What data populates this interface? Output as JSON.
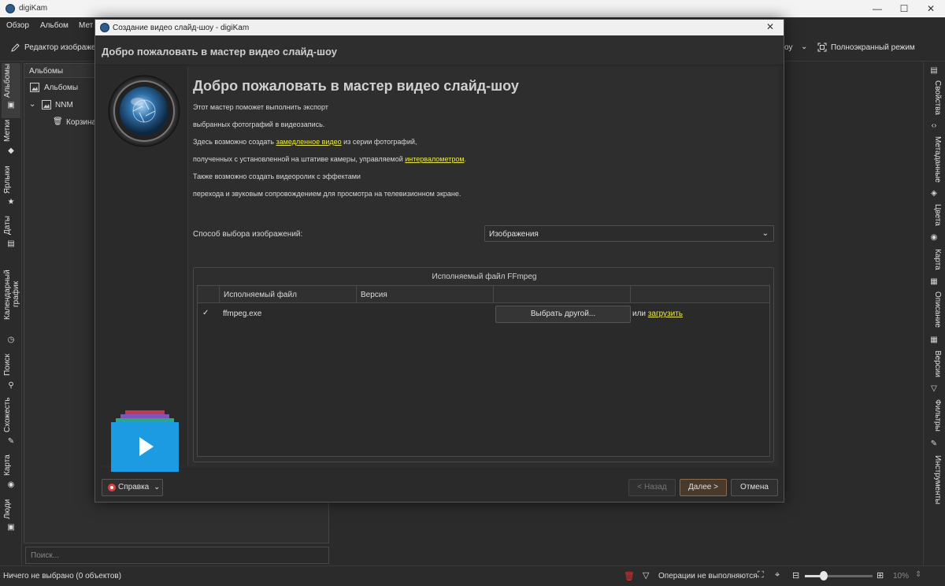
{
  "app": {
    "title": "digiKam",
    "menu": [
      "Обзор",
      "Альбом",
      "Мет"
    ],
    "toolbar": {
      "editor_label": "Редактор изображени",
      "slideshow_fragment": "оу",
      "fullscreen_label": "Полноэкранный режим"
    }
  },
  "left_tabs": [
    "Альбомы",
    "Метки",
    "Ярлыки",
    "Даты",
    "Календарный график",
    "Поиск",
    "Схожесть",
    "Карта",
    "Люди"
  ],
  "right_tabs": [
    "Свойства",
    "Метаданные",
    "Цвета",
    "Карта",
    "Описание",
    "Версии",
    "Фильтры",
    "Инструменты"
  ],
  "albums_panel": {
    "header": "Альбомы",
    "items": [
      "Альбомы",
      "NNM",
      "Корзина"
    ],
    "search_placeholder": "Поиск..."
  },
  "status": {
    "selection": "Ничего не выбрано (0 объектов)",
    "operations": "Операции не выполняются",
    "zoom": "10%"
  },
  "dialog": {
    "title": "Создание видео слайд-шоу - digiKam",
    "header": "Добро пожаловать в мастер видео слайд-шоу",
    "heading": "Добро пожаловать в мастер видео слайд-шоу",
    "paragraphs": {
      "p1": "Этот мастер поможет выполнить экспорт",
      "p2": "выбранных фотографий в видеозапись.",
      "p3_before": "Здесь возможно создать ",
      "p3_link": "замедленное видео",
      "p3_after": " из серии фотографий,",
      "p4_before": "полученных с установленной на штативе камеры, управляемой ",
      "p4_link": "интервалометром",
      "p4_after": ".",
      "p5": "Также возможно создать видеоролик с эффектами",
      "p6": "перехода и звуковым сопровождением для просмотра на телевизионном экране."
    },
    "selection_label": "Способ выбора изображений:",
    "selection_value": "Изображения",
    "ffmpeg": {
      "group_title": "Исполняемый файл FFmpeg",
      "columns": [
        "Исполняемый файл",
        "Версия"
      ],
      "row": {
        "check": "✓",
        "file": "ffmpeg.exe",
        "version": ""
      },
      "choose_button": "Выбрать другой...",
      "or_text": "или ",
      "download_link": "загрузить"
    },
    "buttons": {
      "help": "Справка",
      "back": "< Назад",
      "next": "Далее >",
      "cancel": "Отмена"
    }
  }
}
